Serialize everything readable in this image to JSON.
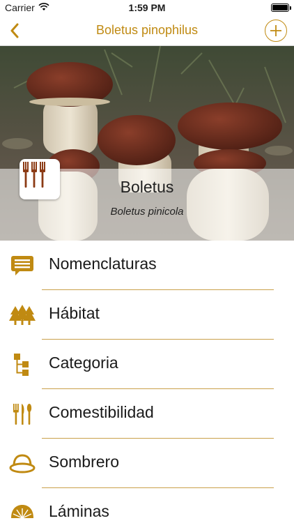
{
  "status_bar": {
    "carrier": "Carrier",
    "time": "1:59 PM"
  },
  "nav": {
    "title": "Boletus pinophilus"
  },
  "hero": {
    "genus": "Boletus",
    "species": "Boletus pinicola"
  },
  "menu": [
    {
      "label": "Nomenclaturas",
      "icon": "speech-bubble-icon"
    },
    {
      "label": "Hábitat",
      "icon": "trees-icon"
    },
    {
      "label": "Categoria",
      "icon": "hierarchy-icon"
    },
    {
      "label": "Comestibilidad",
      "icon": "cutlery-icon"
    },
    {
      "label": "Sombrero",
      "icon": "mushroom-cap-icon"
    },
    {
      "label": "Láminas",
      "icon": "gills-icon"
    }
  ],
  "colors": {
    "accent": "#c08a12",
    "badge_forks": "#8b3a14",
    "separator": "#c9a04a"
  }
}
